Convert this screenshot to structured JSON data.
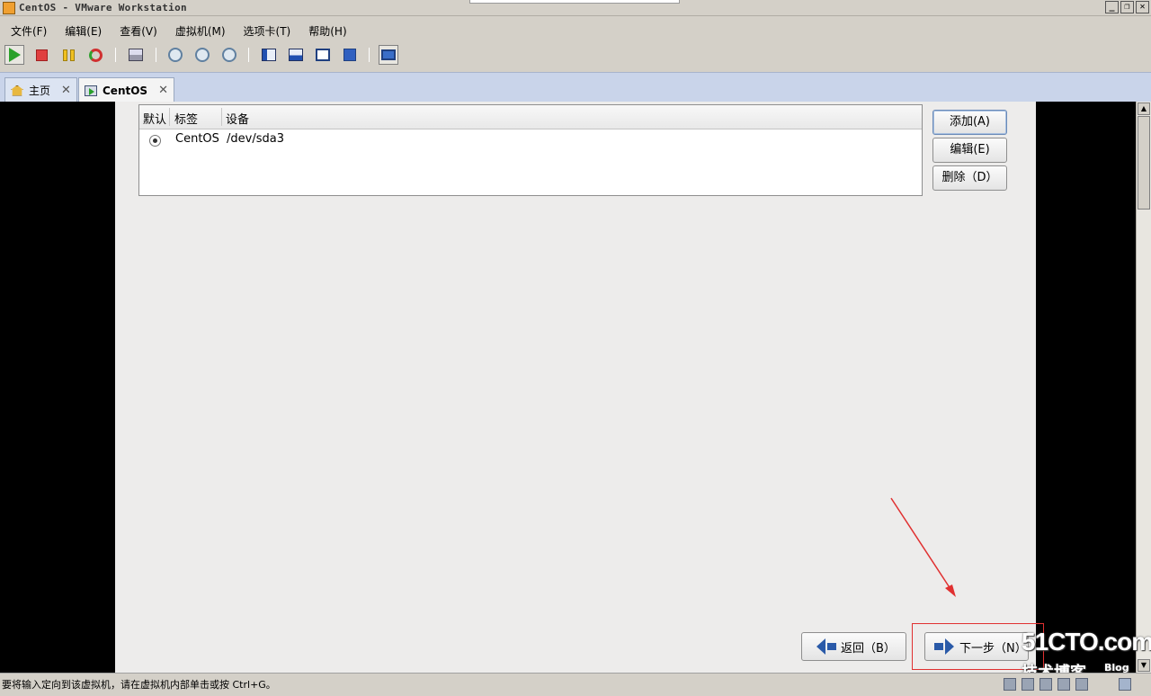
{
  "window": {
    "title": "CentOS - VMware Workstation",
    "buttons": [
      "_",
      "❐",
      "✕"
    ]
  },
  "menu": [
    {
      "label": "文件(F)"
    },
    {
      "label": "编辑(E)"
    },
    {
      "label": "查看(V)"
    },
    {
      "label": "虚拟机(M)"
    },
    {
      "label": "选项卡(T)"
    },
    {
      "label": "帮助(H)"
    }
  ],
  "tabs": [
    {
      "label": "主页",
      "close": "✕"
    },
    {
      "label": "CentOS",
      "close": "✕"
    }
  ],
  "bootloader": {
    "headers": [
      "默认",
      "标签",
      "设备"
    ],
    "rows": [
      {
        "label": "CentOS",
        "device": "/dev/sda3"
      }
    ],
    "buttons": {
      "add": "添加(A)",
      "edit": "编辑(E)",
      "delete": "删除（D）"
    }
  },
  "nav": {
    "back": "返回（B）",
    "next": "下一步（N）"
  },
  "status": {
    "message": "要将输入定向到该虚拟机，请在虚拟机内部单击或按 Ctrl+G。"
  },
  "watermark": {
    "main": "51CTO.com",
    "sub": "技术博客",
    "blog": "Blog"
  },
  "colors": {
    "highlight": "#e03030",
    "arrow": "#2a5aa8",
    "tab_bar": "#c9d4ea"
  }
}
